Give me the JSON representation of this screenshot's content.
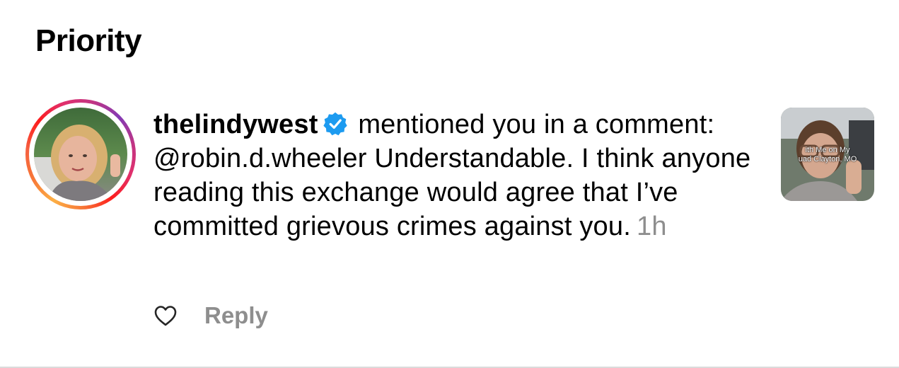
{
  "section": {
    "title": "Priority"
  },
  "notification": {
    "username": "thelindywest",
    "verified": true,
    "action_text": " mentioned you in a comment: @robin.d.wheeler Understandable. I think anyone reading this exchange would agree that I’ve committed grievous crimes against you.",
    "timestamp": "1h",
    "thumbnail_caption_line1": "ith Me on My",
    "thumbnail_caption_line2": "uad Clayton, MO",
    "reply_label": "Reply"
  },
  "colors": {
    "verified_blue": "#1d9bf0",
    "muted_text": "#8e8e8e",
    "divider": "#dbdbdb"
  },
  "icons": {
    "verified": "verified-badge-icon",
    "like": "heart-outline-icon"
  }
}
